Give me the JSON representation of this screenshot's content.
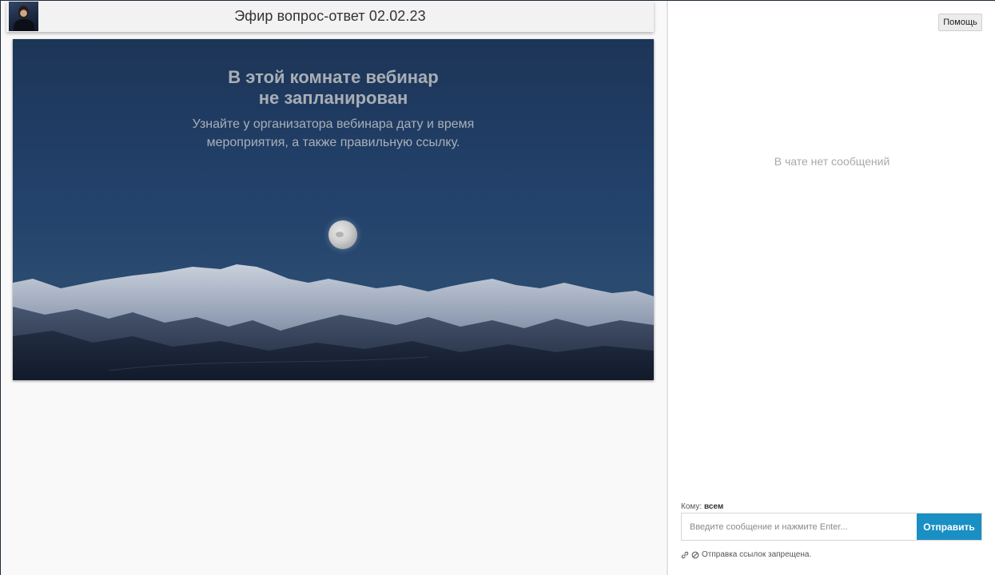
{
  "header": {
    "title": "Эфир вопрос-ответ 02.02.23"
  },
  "video": {
    "notice_title_line1": "В этой комнате вебинар",
    "notice_title_line2": "не запланирован",
    "notice_text_line1": "Узнайте у организатора вебинара дату и время",
    "notice_text_line2": "мероприятия, а также правильную ссылку."
  },
  "chat": {
    "help_label": "Помощь",
    "empty_text": "В чате нет сообщений",
    "recipient_label": "Кому:",
    "recipient_value": "всем",
    "input_placeholder": "Введите сообщение и нажмите Enter...",
    "send_label": "Отправить",
    "links_note": "Отправка ссылок запрещена."
  },
  "icons": {
    "avatar": "host-avatar",
    "link": "link-icon",
    "forbidden": "no-entry-icon"
  },
  "colors": {
    "send_button": "#1a8fc4",
    "sky_top": "#1d3557",
    "empty_text": "#a9a9a9"
  }
}
